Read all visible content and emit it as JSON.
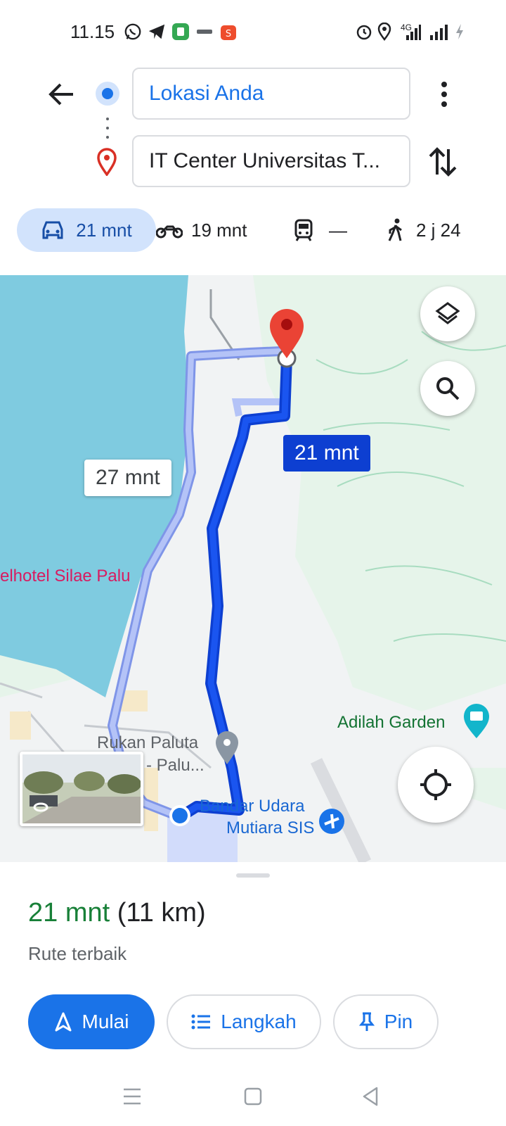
{
  "status_bar": {
    "time": "11.15",
    "left_icons": [
      "whatsapp-icon",
      "telegram-icon",
      "app-icon",
      "app-icon",
      "shopee-icon"
    ],
    "right_icons": [
      "alarm-icon",
      "location-icon",
      "signal-4g-icon",
      "signal-icon",
      "charging-icon"
    ],
    "network_label": "4G"
  },
  "header": {
    "origin_value": "Lokasi Anda",
    "destination_value": "IT Center Universitas T..."
  },
  "modes": [
    {
      "icon": "car-icon",
      "label": "21 mnt",
      "active": true
    },
    {
      "icon": "motorcycle-icon",
      "label": "19 mnt"
    },
    {
      "icon": "train-icon",
      "label": "—"
    },
    {
      "icon": "walk-icon",
      "label": "2 j 24"
    }
  ],
  "map": {
    "route_alt_label": "27 mnt",
    "route_main_label": "21 mnt",
    "places": {
      "hotel": "elhotel Silae Palu",
      "garden": "Adilah Garden",
      "rukan_line1": "Rukan Paluta",
      "rukan_line2": "- Palu...",
      "airport_line1": "Bandar Udara",
      "airport_line2": "Mutiara SIS"
    }
  },
  "sheet": {
    "eta_time": "21 mnt",
    "eta_distance": "(11 km)",
    "route_desc": "Rute terbaik",
    "start_label": "Mulai",
    "steps_label": "Langkah",
    "pin_label": "Pin"
  },
  "colors": {
    "accent": "#1a73e8",
    "route_main": "#0d3fd1",
    "route_alt": "#aab8f5",
    "eta_green": "#188038",
    "water": "#7fcbe0",
    "park": "#c8ecd4"
  }
}
